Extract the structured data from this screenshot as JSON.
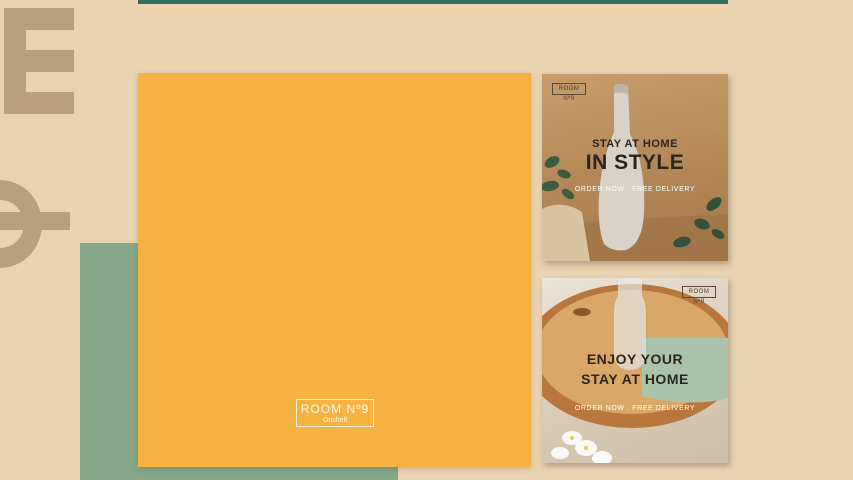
{
  "main": {
    "logo": {
      "name": "ROOM Nº9",
      "tagline": "Onshelf"
    }
  },
  "cards": [
    {
      "logo": "ROOM Nº9",
      "line1": "STAY AT HOME",
      "line2": "IN STYLE",
      "cta": "ORDER NOW . FREE DELIVERY"
    },
    {
      "logo": "ROOM Nº9",
      "line1": "ENJOY YOUR",
      "line2": "STAY AT HOME",
      "cta": "ORDER NOW . FREE DELIVERY"
    }
  ],
  "colors": {
    "background": "#e9d3b1",
    "panel": "#f6b342",
    "green": "#86a788",
    "teal_strip": "#2f6d5e",
    "giant_letters": "#b9a07d"
  }
}
